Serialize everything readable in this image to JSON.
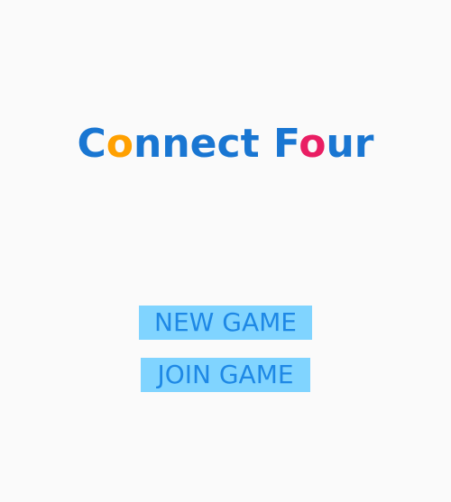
{
  "title": {
    "letters": [
      {
        "char": "C",
        "color": "#1976d2"
      },
      {
        "char": "o",
        "color": "#ffa000"
      },
      {
        "char": "nnect",
        "color": "#1976d2"
      },
      {
        "char": " ",
        "color": "#1976d2"
      },
      {
        "char": "F",
        "color": "#1976d2"
      },
      {
        "char": "o",
        "color": "#e91e63"
      },
      {
        "char": "ur",
        "color": "#1976d2"
      }
    ]
  },
  "menu": {
    "new_game_label": "NEW GAME",
    "join_game_label": "JOIN GAME"
  },
  "colors": {
    "background": "#fafafa",
    "button_bg": "#80d4ff",
    "button_text": "#1e88e5",
    "title_blue": "#1976d2",
    "accent_orange": "#ffa000",
    "accent_pink": "#e91e63"
  }
}
